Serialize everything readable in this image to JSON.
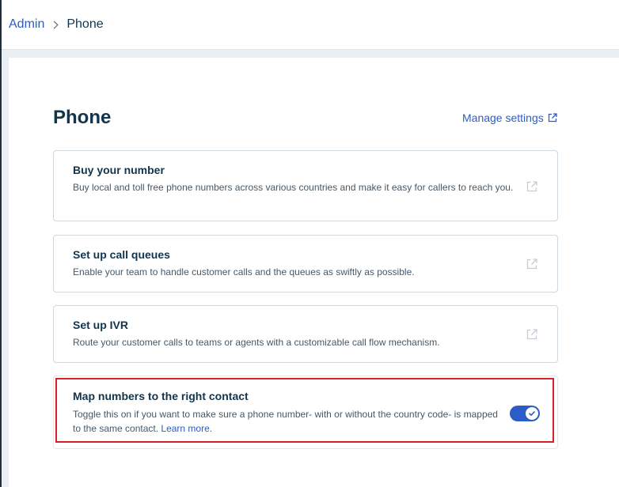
{
  "breadcrumb": {
    "admin": "Admin",
    "current": "Phone"
  },
  "page": {
    "title": "Phone",
    "manage_link": "Manage settings"
  },
  "cards": [
    {
      "title": "Buy your number",
      "description": "Buy local and toll free phone numbers across various countries and make it easy for callers to reach you."
    },
    {
      "title": "Set up call queues",
      "description": "Enable your team to handle customer calls and the queues as swiftly as possible."
    },
    {
      "title": "Set up IVR",
      "description": "Route your customer calls to teams or agents with a customizable call flow mechanism."
    }
  ],
  "map_numbers": {
    "title": "Map numbers to the right contact",
    "description": "Toggle this on if you want to make sure a phone number- with or without the country code- is mapped to the same contact.",
    "learn_more": "Learn more.",
    "toggle_on": true
  },
  "colors": {
    "accent": "#2c5cc5",
    "heading": "#12344d",
    "highlight": "#d6202b"
  },
  "icons": {
    "external_link": "external-link-icon",
    "breadcrumb_separator": "chevron-right-icon",
    "toggle_check": "check-icon"
  }
}
